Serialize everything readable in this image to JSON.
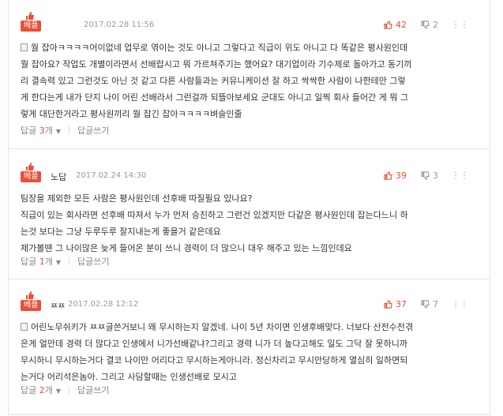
{
  "comments": [
    {
      "badge": "베플",
      "author": "",
      "date": "2017.02.28 11:56",
      "up": "42",
      "down": "2",
      "lines": [
        "뭘 잡아ㅋㅋㅋㅋ어이없네 업무로 엮이는 것도 아니고 그렇다고 직급이 위도 아니고 다 똑같은 평사원인데",
        "뭘 잡아요? 작업도 개별이라면서 선배랍시고 뭐 가르쳐주기는 했어요? 대기업이라 기수제로 돌아가고 동기끼",
        "리 결속력 있고 그런것도 아닌 것 같고 다른 사람들과는 커뮤니케이션 잘 하고 싹싹한 사람이 나한테만 그렇",
        "게 한다는게 내가 단지 나이 어린 선배라서 그런걸까 되뜰아보세요 군대도 아니고 일찍 회사 들어간 게 뭐 그",
        "렇게 대단한거라고 평사원끼리 뭘 잡긴 잡아ㅋㅋㅋㅋ벼슬인줄"
      ],
      "reply_label": "답글",
      "reply_count": "3",
      "reply_unit": "개",
      "write_label": "답글쓰기"
    },
    {
      "badge": "베플",
      "author": "노답",
      "date": "2017.02.24 14:30",
      "up": "39",
      "down": "3",
      "lines": [
        "팀장을 제외한 모든 사람은 평사원인데 선후배 따질필요 있나요?",
        "직급이 있는 회사라면 선후배 따져서 누가 먼저 승진하고 그런건 있겠지만 다같은 평사원인데 잡는다느니 하",
        "는것 보다는 그냥 두루두루 잘지내는게 좋을거 같은데요",
        "제가볼땐 그 나이많은 늦게 들어온 분이 쓰니 경력이 더 많으니 대우 해주고 있는 느낌인데요"
      ],
      "reply_label": "답글",
      "reply_count": "1",
      "reply_unit": "개",
      "write_label": "답글쓰기"
    },
    {
      "badge": "베플",
      "author": "ㅉㅉ",
      "date": "2017.02.28 12:12",
      "up": "37",
      "down": "7",
      "lines": [
        "어린노무쉬키가 ㅉㅉ글쓴거보니 왜 무시하는지 알겠네. 나이 5년 차이면 인생후배맞다. 너보다 산전수전겪",
        "은게 얼만데 경력 더 많다고 인생에서 니가선배같냐?그리고 경력 니가 더 높다고해도 일도 그닥 잘 못하니까",
        "무시하니 무시하는거다 결코 나이만 어리다고 무시하는게아니라. 정신차리고 무시안당하게 열심히 일하면되",
        "는거다 어리석은놈아. 그리고 사담할때는 인생선배로 모시고"
      ],
      "reply_label": "답글",
      "reply_count": "2",
      "reply_unit": "개",
      "write_label": "답글쓰기"
    }
  ],
  "colors": {
    "accent": "#e8503a",
    "muted": "#999999"
  },
  "icons": {
    "up": "thumbs-up-icon",
    "down": "thumbs-down-icon",
    "more": "more-dots-icon",
    "badge": "thumbs-up-badge-icon"
  }
}
